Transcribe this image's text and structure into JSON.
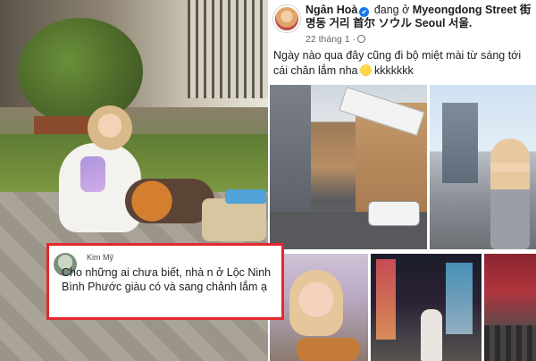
{
  "post": {
    "author": "Ngân Hoà",
    "verified_icon": "✔",
    "checkin_text": " đang ở ",
    "location": "Myeongdong Street 街 명동 거리 首尔 ソウル Seoul 서울.",
    "meta": "22 tháng 1 ·",
    "caption": "Ngày nào qua đây cũng đi bộ miệt mài từ sáng tới cái chân lắm nha",
    "caption_tail": " kkkkkkk"
  },
  "comment": {
    "author": "Kim Mỹ",
    "text": "Cho những ai chưa biết, nhà n ở Lộc Ninh Bình Phước giàu có và sang chảnh lắm ạ",
    "border_color": "#e5282e"
  },
  "colors": {
    "verified": "#1877f2",
    "meta_gray": "#65676b",
    "highlight_border": "#e5282e"
  },
  "icons": {
    "verified": "verified-badge-icon",
    "globe": "globe-icon",
    "emoji": "laughing-emoji-icon"
  }
}
